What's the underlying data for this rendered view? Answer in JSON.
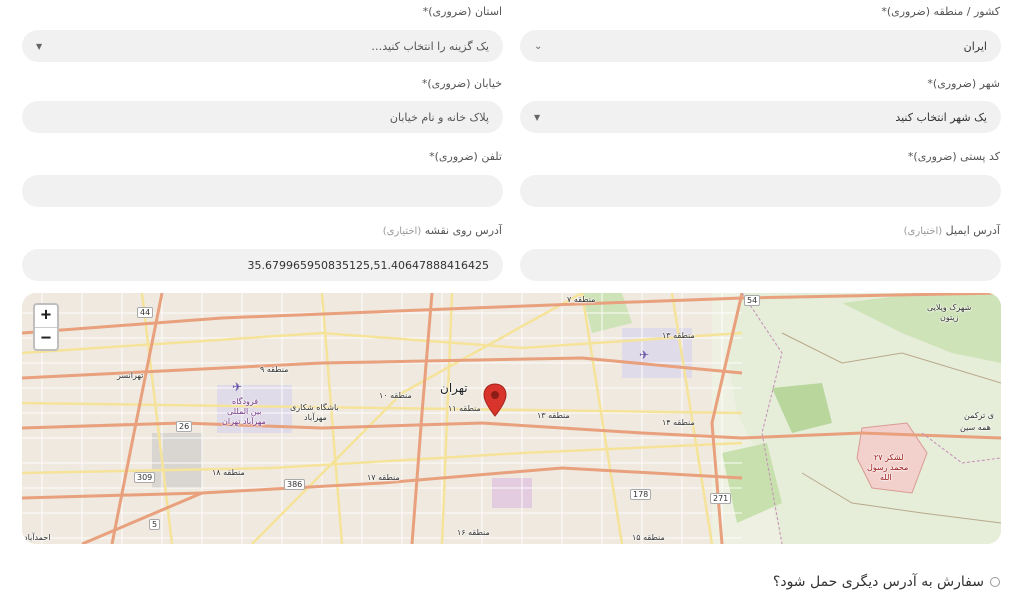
{
  "form": {
    "country": {
      "label": "کشور / منطقه (ضروری)*",
      "value": "ایران"
    },
    "province": {
      "label": "استان (ضروری)*",
      "placeholder": "یک گزینه را انتخاب کنید…"
    },
    "city": {
      "label": "شهر (ضروری)*",
      "placeholder": "یک شهر انتخاب کنید"
    },
    "street": {
      "label": "خیابان (ضروری)*",
      "placeholder": "پلاک خانه و نام خیابان"
    },
    "postcode": {
      "label": "کد پستی (ضروری)*",
      "value": ""
    },
    "phone": {
      "label": "تلفن (ضروری)*",
      "value": ""
    },
    "email": {
      "label": "آدرس ایمیل",
      "optional": "(اختیاری)",
      "value": ""
    },
    "map_address": {
      "label": "آدرس روی نقشه",
      "optional": "(اختیاری)",
      "value": "35.679965950835125,51.40647888416425"
    }
  },
  "map": {
    "zoom_in": "+",
    "zoom_out": "−",
    "city_label": "تهران",
    "labels": {
      "r7": "منطقه ۷",
      "r13a": "منطقه ۱۳",
      "r9": "منطقه ۹",
      "r10": "منطقه ۱۰",
      "r11": "منطقه ۱۱",
      "r13b": "منطقه ۱۳",
      "r14": "منطقه ۱۴",
      "r18": "منطقه ۱۸",
      "r17": "منطقه ۱۷",
      "r16": "منطقه ۱۶",
      "r15": "منطقه ۱۵",
      "tehransar": "تهرانسر",
      "airport1": "فرودگاه",
      "airport2": "بین المللی",
      "airport3": "مهرآباد تهران",
      "club1": "باشگاه شکاری",
      "club2": "مهرآباد",
      "villa1": "شهرک ویلایی",
      "villa2": "زیتون",
      "torkaman1": "ی ترکمن",
      "torkaman2": "همه سین",
      "army1": "لشکر ۲۷",
      "army2": "محمد رسول",
      "army3": "الله",
      "ahmadabad": "احمدآباد"
    },
    "roads": {
      "r44": "44",
      "r26": "26",
      "r309": "309",
      "r386": "386",
      "r5": "5",
      "r54": "54",
      "r178": "178",
      "r271": "271"
    }
  },
  "ship_other": {
    "label": "سفارش به آدرس دیگری حمل شود؟"
  }
}
